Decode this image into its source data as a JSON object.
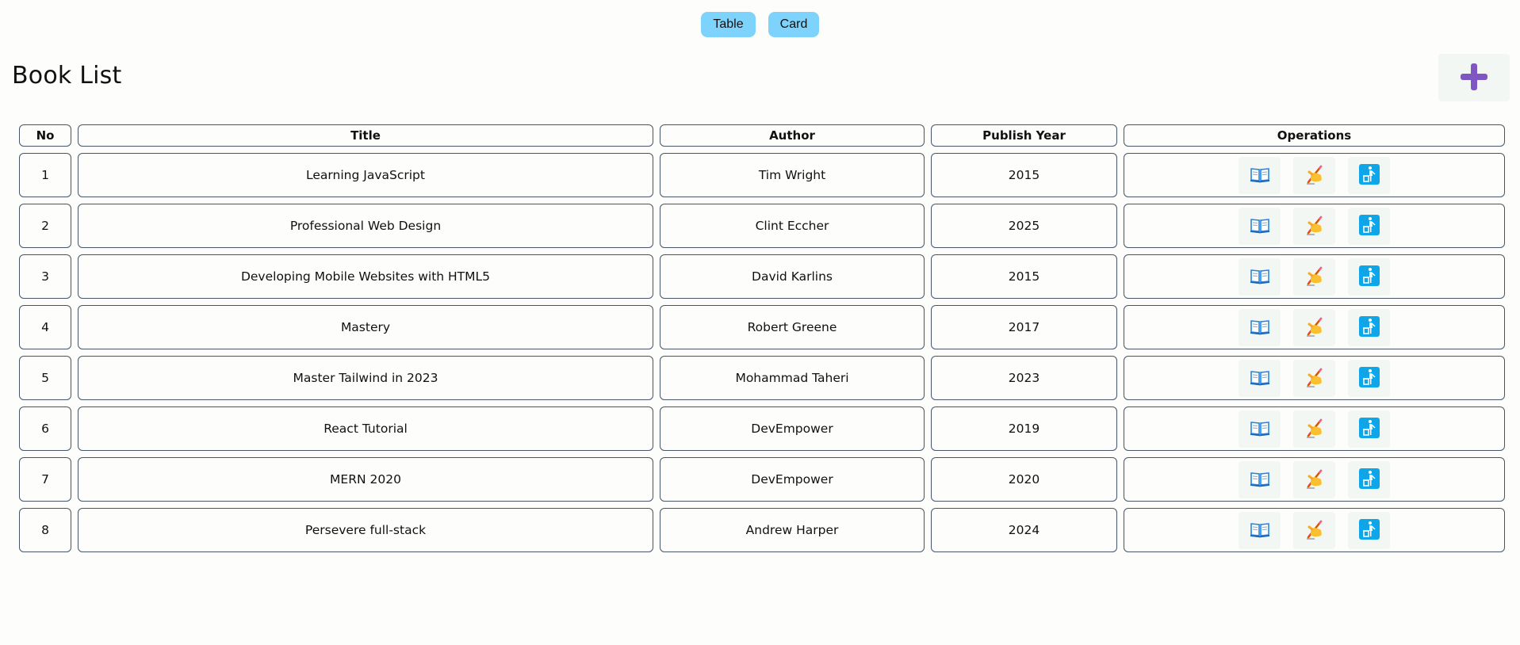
{
  "view_toggle": {
    "table_label": "Table",
    "card_label": "Card"
  },
  "header": {
    "title": "Book List",
    "add_icon": "plus-icon",
    "add_icon_color": "#7e57c2"
  },
  "table": {
    "columns": [
      "No",
      "Title",
      "Author",
      "Publish Year",
      "Operations"
    ],
    "rows": [
      {
        "no": "1",
        "title": "Learning JavaScript",
        "author": "Tim Wright",
        "year": "2015"
      },
      {
        "no": "2",
        "title": "Professional Web Design",
        "author": "Clint Eccher",
        "year": "2025"
      },
      {
        "no": "3",
        "title": "Developing Mobile Websites with HTML5",
        "author": "David Karlins",
        "year": "2015"
      },
      {
        "no": "4",
        "title": "Mastery",
        "author": "Robert Greene",
        "year": "2017"
      },
      {
        "no": "5",
        "title": "Master Tailwind in 2023",
        "author": "Mohammad Taheri",
        "year": "2023"
      },
      {
        "no": "6",
        "title": "React Tutorial",
        "author": "DevEmpower",
        "year": "2019"
      },
      {
        "no": "7",
        "title": "MERN 2020",
        "author": "DevEmpower",
        "year": "2020"
      },
      {
        "no": "8",
        "title": "Persevere full-stack",
        "author": "Andrew Harper",
        "year": "2024"
      }
    ],
    "operation_icons": [
      "open-book-icon",
      "writing-hand-icon",
      "litter-bin-icon"
    ]
  },
  "colors": {
    "toggle_bg": "#7dd3fc",
    "border": "#475569",
    "op_button_bg": "#f3f7f4",
    "bin_icon_bg": "#0ea5e9",
    "book_icon_blue": "#1e88e5",
    "hand_icon_yellow": "#fbc02d"
  }
}
